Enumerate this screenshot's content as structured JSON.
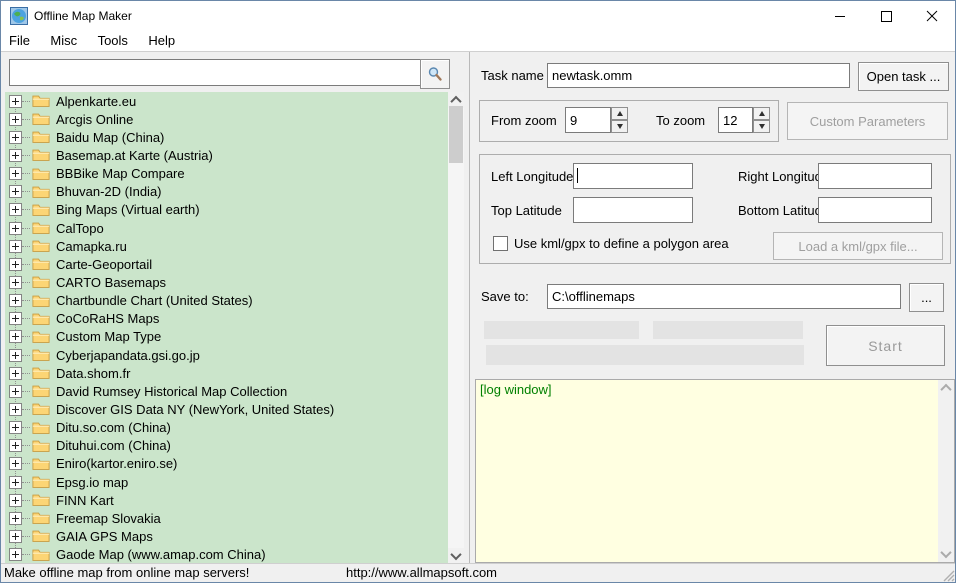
{
  "window": {
    "title": "Offline Map Maker"
  },
  "menu": {
    "items": [
      "File",
      "Misc",
      "Tools",
      "Help"
    ]
  },
  "search": {
    "value": "",
    "placeholder": ""
  },
  "tree": {
    "items": [
      "Alpenkarte.eu",
      "Arcgis Online",
      "Baidu Map (China)",
      "Basemap.at Karte (Austria)",
      "BBBike Map Compare",
      "Bhuvan-2D (India)",
      "Bing Maps (Virtual earth)",
      "CalTopo",
      "Camapka.ru",
      "Carte-Geoportail",
      "CARTO Basemaps",
      "Chartbundle Chart (United States)",
      "CoCoRaHS Maps",
      "Custom Map Type",
      "Cyberjapandata.gsi.go.jp",
      "Data.shom.fr",
      "David Rumsey Historical Map Collection",
      "Discover GIS Data NY (NewYork, United States)",
      "Ditu.so.com (China)",
      "Dituhui.com (China)",
      "Eniro(kartor.eniro.se)",
      "Epsg.io map",
      "FINN Kart",
      "Freemap Slovakia",
      "GAIA GPS Maps",
      "Gaode Map (www.amap.com China)"
    ]
  },
  "task": {
    "label": "Task name",
    "value": "newtask.omm",
    "open_button": "Open task ..."
  },
  "zoom": {
    "from_label": "From zoom",
    "from_value": "9",
    "to_label": "To zoom",
    "to_value": "12",
    "custom_parameters_button": "Custom Parameters"
  },
  "area": {
    "left_longitude_label": "Left Longitude",
    "right_longitude_label": "Right Longitude",
    "top_latitude_label": "Top Latitude",
    "bottom_latitude_label": "Bottom Latitude",
    "left_longitude_value": "",
    "right_longitude_value": "",
    "top_latitude_value": "",
    "bottom_latitude_value": "",
    "kml_checkbox_label": "Use kml/gpx to define a polygon area",
    "kml_checked": false,
    "load_kml_button": "Load a kml/gpx file..."
  },
  "save": {
    "label": "Save to:",
    "path": "C:\\offlinemaps",
    "browse_button": "..."
  },
  "actions": {
    "start_button": "Start"
  },
  "log": {
    "text": "[log window]"
  },
  "statusbar": {
    "message": "Make offline map from online map servers!",
    "url": "http://www.allmapsoft.com"
  },
  "colors": {
    "tree_background": "#cbe5cb",
    "log_background": "#ffffe1",
    "log_text": "#008000",
    "disabled_text": "#9f9f9f",
    "client_background": "#f0f0f0"
  }
}
